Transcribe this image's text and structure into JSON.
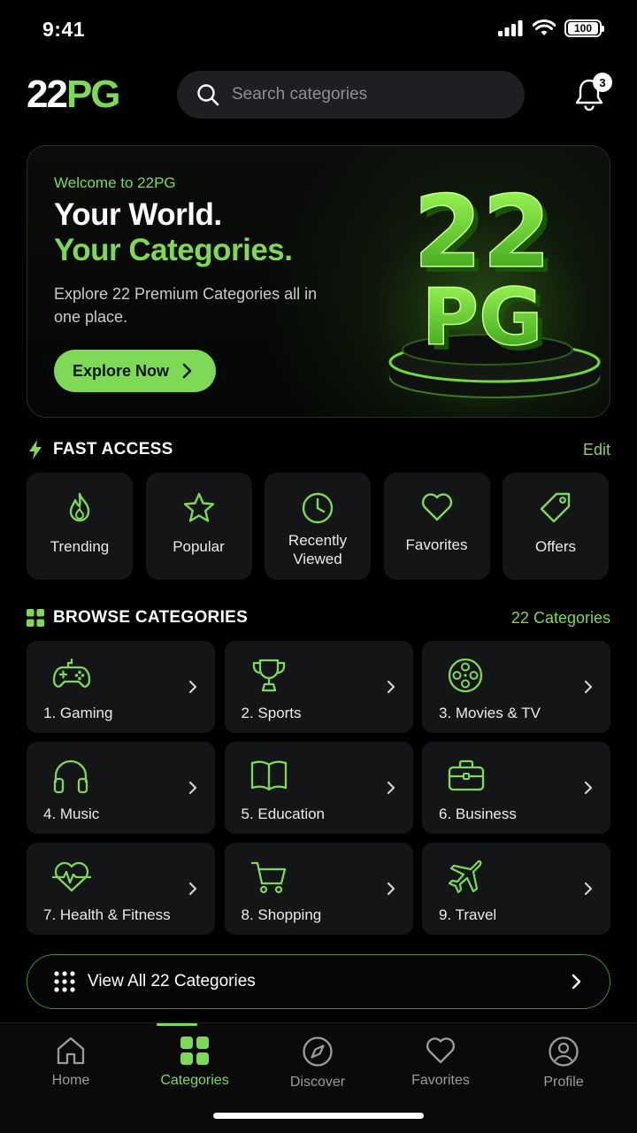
{
  "status": {
    "time": "9:41",
    "battery": "100"
  },
  "header": {
    "logo_part1": "22",
    "logo_part2": "PG",
    "search_placeholder": "Search categories",
    "notifications_count": "3"
  },
  "hero": {
    "kicker": "Welcome to 22PG",
    "title_line1": "Your World.",
    "title_line2": "Your Categories.",
    "subtitle": "Explore 22 Premium Categories all in one place.",
    "cta_label": "Explore Now",
    "art_text_top": "22",
    "art_text_bottom": "PG"
  },
  "fast_access": {
    "title": "FAST ACCESS",
    "action": "Edit",
    "items": [
      {
        "label": "Trending",
        "icon": "flame-icon"
      },
      {
        "label": "Popular",
        "icon": "star-icon"
      },
      {
        "label": "Recently Viewed",
        "icon": "clock-icon"
      },
      {
        "label": "Favorites",
        "icon": "heart-icon"
      },
      {
        "label": "Offers",
        "icon": "tag-icon"
      }
    ]
  },
  "browse": {
    "title": "BROWSE CATEGORIES",
    "count_label": "22 Categories",
    "items": [
      {
        "label": "1. Gaming",
        "icon": "gamepad-icon"
      },
      {
        "label": "2. Sports",
        "icon": "trophy-icon"
      },
      {
        "label": "3. Movies & TV",
        "icon": "film-reel-icon"
      },
      {
        "label": "4. Music",
        "icon": "headphones-icon"
      },
      {
        "label": "5. Education",
        "icon": "book-icon"
      },
      {
        "label": "6. Business",
        "icon": "briefcase-icon"
      },
      {
        "label": "7. Health & Fitness",
        "icon": "heartbeat-icon"
      },
      {
        "label": "8. Shopping",
        "icon": "cart-icon"
      },
      {
        "label": "9. Travel",
        "icon": "airplane-icon"
      }
    ],
    "view_all_label": "View All 22 Categories"
  },
  "tabbar": {
    "items": [
      {
        "label": "Home",
        "icon": "home-icon",
        "active": false
      },
      {
        "label": "Categories",
        "icon": "grid-icon",
        "active": true
      },
      {
        "label": "Discover",
        "icon": "compass-icon",
        "active": false
      },
      {
        "label": "Favorites",
        "icon": "heart-icon",
        "active": false
      },
      {
        "label": "Profile",
        "icon": "user-icon",
        "active": false
      }
    ]
  },
  "colors": {
    "accent": "#7ed957",
    "background": "#000000",
    "card": "#141516"
  }
}
